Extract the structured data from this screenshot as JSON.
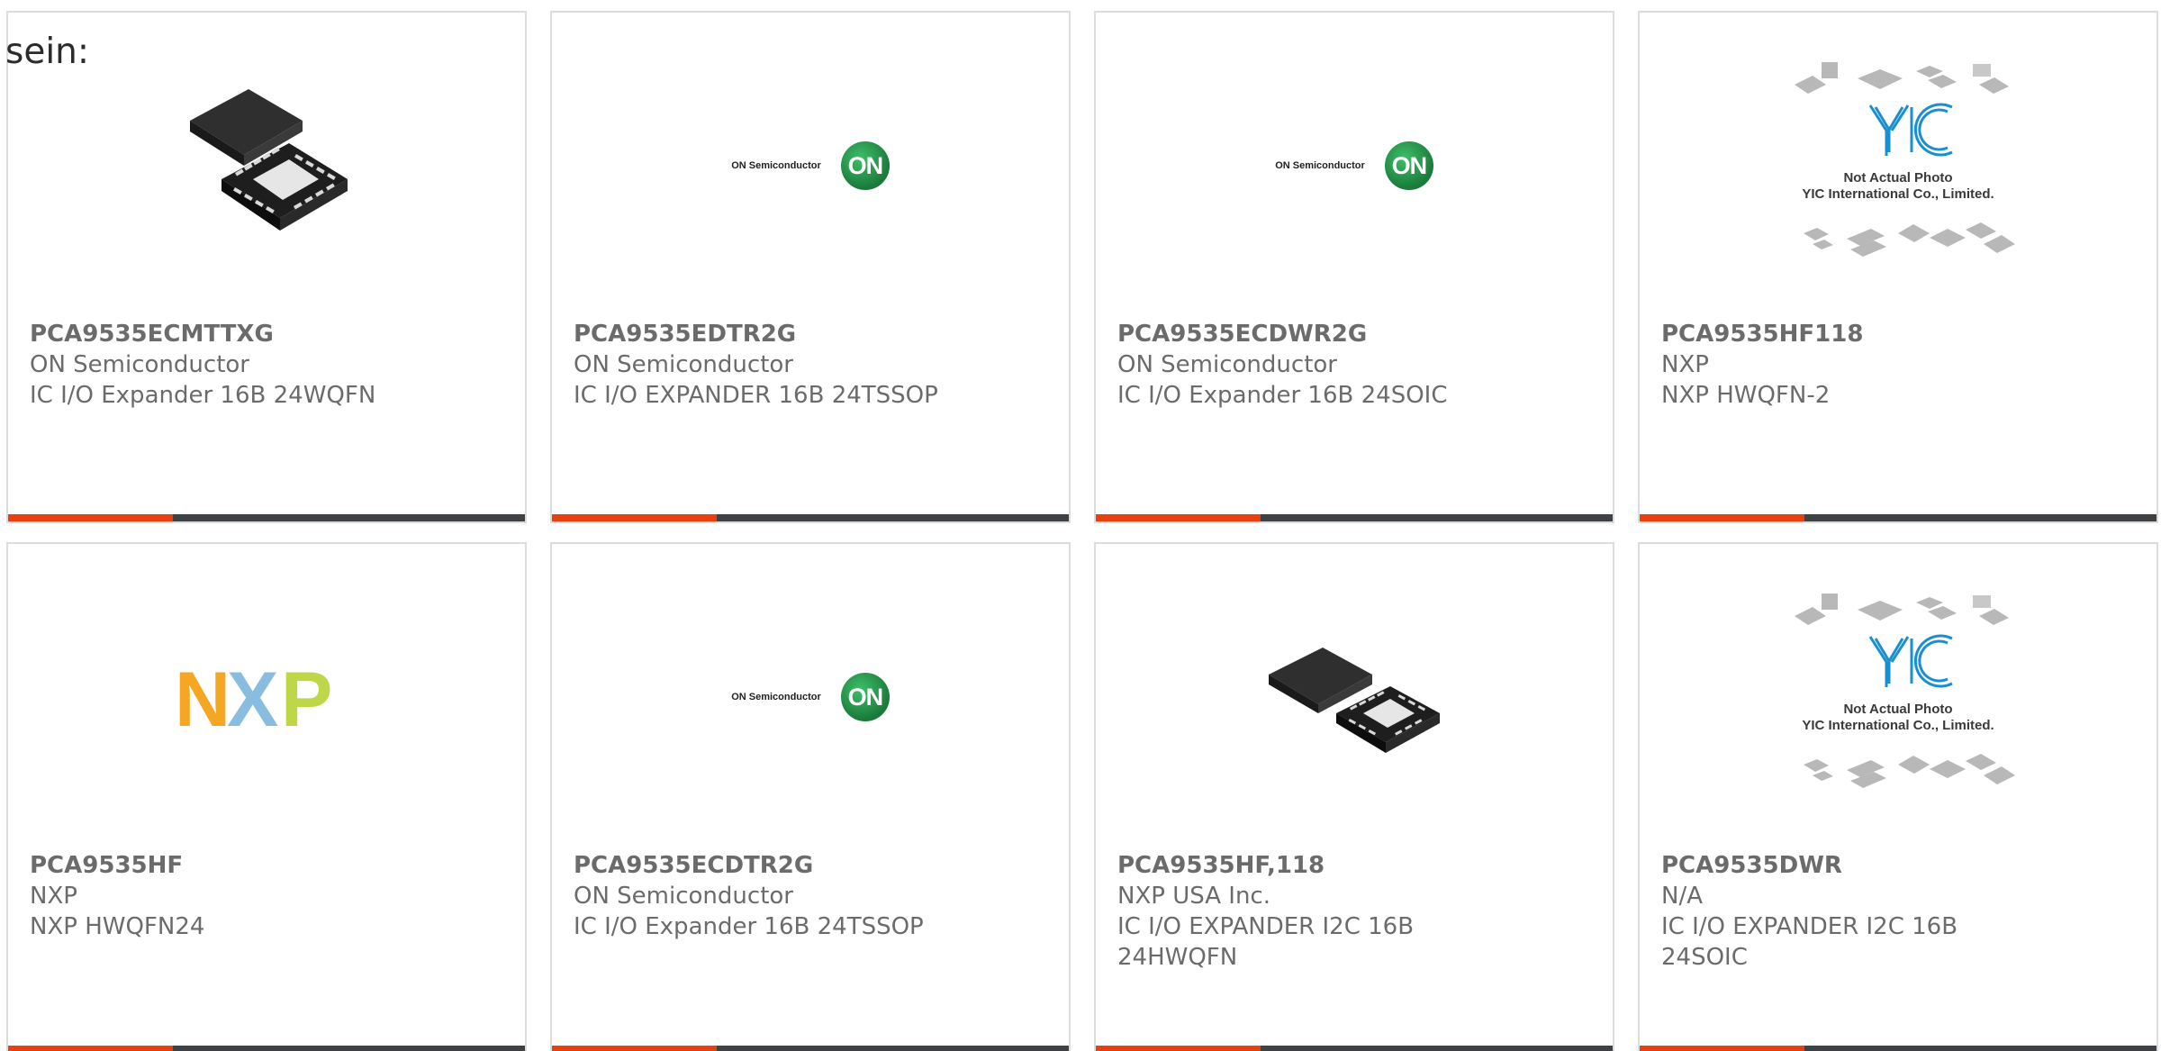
{
  "intro": {
    "text": "sein:"
  },
  "products": [
    {
      "part_number": "PCA9535ECMTTXG",
      "manufacturer": "ON Semiconductor",
      "description": "IC I/O Expander 16B 24WQFN",
      "image": "qfn-chip-photo"
    },
    {
      "part_number": "PCA9535EDTR2G",
      "manufacturer": "ON Semiconductor",
      "description": "IC I/O EXPANDER 16B 24TSSOP",
      "image": "on-semiconductor-logo"
    },
    {
      "part_number": "PCA9535ECDWR2G",
      "manufacturer": "ON Semiconductor",
      "description": "IC I/O Expander 16B 24SOIC",
      "image": "on-semiconductor-logo"
    },
    {
      "part_number": "PCA9535HF118",
      "manufacturer": "NXP",
      "description": "NXP HWQFN-2",
      "image": "yic-not-actual-photo"
    },
    {
      "part_number": "PCA9535HF",
      "manufacturer": "NXP",
      "description": "NXP HWQFN24",
      "image": "nxp-logo"
    },
    {
      "part_number": "PCA9535ECDTR2G",
      "manufacturer": "ON Semiconductor",
      "description": "IC I/O Expander 16B 24TSSOP",
      "image": "on-semiconductor-logo"
    },
    {
      "part_number": "PCA9535HF,118",
      "manufacturer": "NXP USA Inc.",
      "description": "IC I/O EXPANDER I2C 16B 24HWQFN",
      "image": "qfn-chip-photo"
    },
    {
      "part_number": "PCA9535DWR",
      "manufacturer": "N/A",
      "description": "IC I/O EXPANDER I2C 16B 24SOIC",
      "image": "yic-not-actual-photo"
    }
  ],
  "logos": {
    "on_semiconductor_text": "ON Semiconductor",
    "on_badge": "ON",
    "yic_caption_line1": "Not Actual Photo",
    "yic_caption_line2": "YIC International Co., Limited.",
    "nxp_letters": [
      "N",
      "X",
      "P"
    ]
  },
  "colors": {
    "accent": "#e8400f",
    "bar_dark": "#3f4244",
    "card_border": "#dcdcdc",
    "text_gray": "#6b6b6b",
    "on_green": "#1a7a3a",
    "nxp_orange": "#f5a623",
    "nxp_blue": "#7bb6dd",
    "nxp_green": "#b7d334",
    "yic_blue": "#1a8fd0"
  }
}
